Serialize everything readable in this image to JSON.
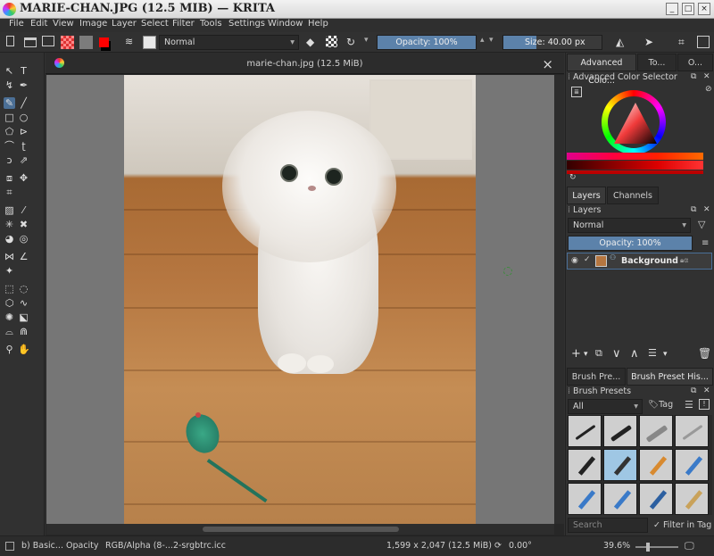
{
  "window": {
    "title": "MARIE-CHAN.JPG (12.5 MIB) — KRITA",
    "controls": {
      "min": "_",
      "max": "□",
      "close": "×"
    }
  },
  "menu": [
    "File",
    "Edit",
    "View",
    "Image",
    "Layer",
    "Select",
    "Filter",
    "Tools",
    "Settings",
    "Window",
    "Help"
  ],
  "toolbar": {
    "blend_mode": "Normal",
    "opacity": "Opacity: 100%",
    "opacity_value": 1.0,
    "size": "Size: 40.00 px",
    "size_value": 40
  },
  "document": {
    "tab_title": "marie-chan.jpg (12.5 MiB)",
    "close": "×"
  },
  "dock": {
    "top_tabs": [
      "Advanced Colo...",
      "To...",
      "O..."
    ],
    "color_selector_title": "Advanced Color Selector",
    "layer_tabs": [
      "Layers",
      "Channels"
    ],
    "layers_title": "Layers",
    "layer_blend": "Normal",
    "layer_opacity": "Opacity:  100%",
    "layers": [
      {
        "name": "Background"
      }
    ],
    "brush_tabs": [
      "Brush Pre...",
      "Brush Preset His..."
    ],
    "brush_presets_title": "Brush Presets",
    "brush_filter": "All",
    "tag_label": "Tag",
    "search_placeholder": "Search",
    "filter_in_tag": "Filter in Tag"
  },
  "status": {
    "brush": "b) Basic... Opacity",
    "colorspace": "RGB/Alpha (8-...2-srgbtrc.icc",
    "dimensions": "1,599 x 2,047 (12.5 MiB)",
    "rotation": "0.00°",
    "zoom": "39.6%"
  },
  "colors": {
    "accent": "#5c82aa",
    "fg": "#ff0000",
    "bg": "#000000"
  }
}
